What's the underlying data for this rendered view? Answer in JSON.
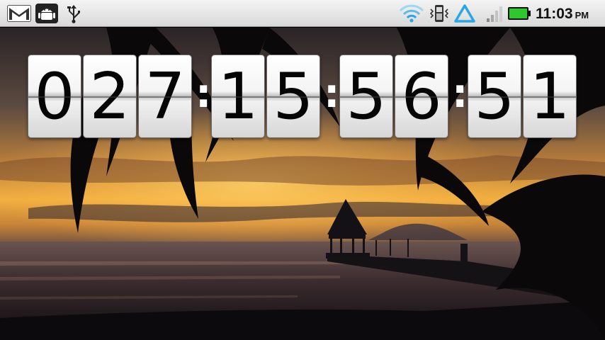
{
  "status_bar": {
    "left_icons": [
      "gmail-icon",
      "android-debug-icon",
      "usb-icon"
    ],
    "right_icons": [
      "wifi-icon",
      "phone-vibrate-icon",
      "sync-icon",
      "signal-icon",
      "battery-icon"
    ],
    "time": "11:03",
    "ampm": "PM",
    "battery_color": "#2cc82c",
    "wifi_color": "#2aa7e0"
  },
  "countdown": {
    "days": [
      "0",
      "2",
      "7"
    ],
    "hours": [
      "1",
      "5"
    ],
    "minutes": [
      "5",
      "6"
    ],
    "seconds": [
      "5",
      "1"
    ],
    "separator": ":"
  },
  "wallpaper": {
    "description_icon": "beach-sunset-wallpaper"
  }
}
